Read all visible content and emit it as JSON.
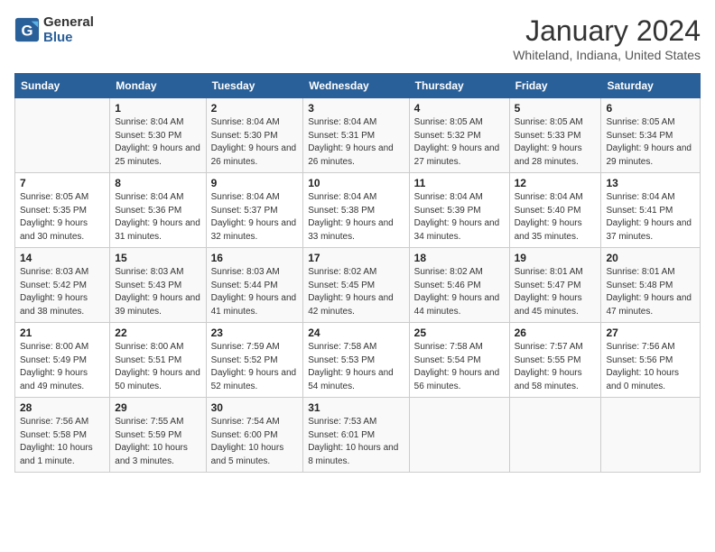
{
  "header": {
    "logo_line1": "General",
    "logo_line2": "Blue",
    "month": "January 2024",
    "location": "Whiteland, Indiana, United States"
  },
  "weekdays": [
    "Sunday",
    "Monday",
    "Tuesday",
    "Wednesday",
    "Thursday",
    "Friday",
    "Saturday"
  ],
  "weeks": [
    [
      {
        "day": "",
        "sunrise": "",
        "sunset": "",
        "daylight": ""
      },
      {
        "day": "1",
        "sunrise": "Sunrise: 8:04 AM",
        "sunset": "Sunset: 5:30 PM",
        "daylight": "Daylight: 9 hours and 25 minutes."
      },
      {
        "day": "2",
        "sunrise": "Sunrise: 8:04 AM",
        "sunset": "Sunset: 5:30 PM",
        "daylight": "Daylight: 9 hours and 26 minutes."
      },
      {
        "day": "3",
        "sunrise": "Sunrise: 8:04 AM",
        "sunset": "Sunset: 5:31 PM",
        "daylight": "Daylight: 9 hours and 26 minutes."
      },
      {
        "day": "4",
        "sunrise": "Sunrise: 8:05 AM",
        "sunset": "Sunset: 5:32 PM",
        "daylight": "Daylight: 9 hours and 27 minutes."
      },
      {
        "day": "5",
        "sunrise": "Sunrise: 8:05 AM",
        "sunset": "Sunset: 5:33 PM",
        "daylight": "Daylight: 9 hours and 28 minutes."
      },
      {
        "day": "6",
        "sunrise": "Sunrise: 8:05 AM",
        "sunset": "Sunset: 5:34 PM",
        "daylight": "Daylight: 9 hours and 29 minutes."
      }
    ],
    [
      {
        "day": "7",
        "sunrise": "Sunrise: 8:05 AM",
        "sunset": "Sunset: 5:35 PM",
        "daylight": "Daylight: 9 hours and 30 minutes."
      },
      {
        "day": "8",
        "sunrise": "Sunrise: 8:04 AM",
        "sunset": "Sunset: 5:36 PM",
        "daylight": "Daylight: 9 hours and 31 minutes."
      },
      {
        "day": "9",
        "sunrise": "Sunrise: 8:04 AM",
        "sunset": "Sunset: 5:37 PM",
        "daylight": "Daylight: 9 hours and 32 minutes."
      },
      {
        "day": "10",
        "sunrise": "Sunrise: 8:04 AM",
        "sunset": "Sunset: 5:38 PM",
        "daylight": "Daylight: 9 hours and 33 minutes."
      },
      {
        "day": "11",
        "sunrise": "Sunrise: 8:04 AM",
        "sunset": "Sunset: 5:39 PM",
        "daylight": "Daylight: 9 hours and 34 minutes."
      },
      {
        "day": "12",
        "sunrise": "Sunrise: 8:04 AM",
        "sunset": "Sunset: 5:40 PM",
        "daylight": "Daylight: 9 hours and 35 minutes."
      },
      {
        "day": "13",
        "sunrise": "Sunrise: 8:04 AM",
        "sunset": "Sunset: 5:41 PM",
        "daylight": "Daylight: 9 hours and 37 minutes."
      }
    ],
    [
      {
        "day": "14",
        "sunrise": "Sunrise: 8:03 AM",
        "sunset": "Sunset: 5:42 PM",
        "daylight": "Daylight: 9 hours and 38 minutes."
      },
      {
        "day": "15",
        "sunrise": "Sunrise: 8:03 AM",
        "sunset": "Sunset: 5:43 PM",
        "daylight": "Daylight: 9 hours and 39 minutes."
      },
      {
        "day": "16",
        "sunrise": "Sunrise: 8:03 AM",
        "sunset": "Sunset: 5:44 PM",
        "daylight": "Daylight: 9 hours and 41 minutes."
      },
      {
        "day": "17",
        "sunrise": "Sunrise: 8:02 AM",
        "sunset": "Sunset: 5:45 PM",
        "daylight": "Daylight: 9 hours and 42 minutes."
      },
      {
        "day": "18",
        "sunrise": "Sunrise: 8:02 AM",
        "sunset": "Sunset: 5:46 PM",
        "daylight": "Daylight: 9 hours and 44 minutes."
      },
      {
        "day": "19",
        "sunrise": "Sunrise: 8:01 AM",
        "sunset": "Sunset: 5:47 PM",
        "daylight": "Daylight: 9 hours and 45 minutes."
      },
      {
        "day": "20",
        "sunrise": "Sunrise: 8:01 AM",
        "sunset": "Sunset: 5:48 PM",
        "daylight": "Daylight: 9 hours and 47 minutes."
      }
    ],
    [
      {
        "day": "21",
        "sunrise": "Sunrise: 8:00 AM",
        "sunset": "Sunset: 5:49 PM",
        "daylight": "Daylight: 9 hours and 49 minutes."
      },
      {
        "day": "22",
        "sunrise": "Sunrise: 8:00 AM",
        "sunset": "Sunset: 5:51 PM",
        "daylight": "Daylight: 9 hours and 50 minutes."
      },
      {
        "day": "23",
        "sunrise": "Sunrise: 7:59 AM",
        "sunset": "Sunset: 5:52 PM",
        "daylight": "Daylight: 9 hours and 52 minutes."
      },
      {
        "day": "24",
        "sunrise": "Sunrise: 7:58 AM",
        "sunset": "Sunset: 5:53 PM",
        "daylight": "Daylight: 9 hours and 54 minutes."
      },
      {
        "day": "25",
        "sunrise": "Sunrise: 7:58 AM",
        "sunset": "Sunset: 5:54 PM",
        "daylight": "Daylight: 9 hours and 56 minutes."
      },
      {
        "day": "26",
        "sunrise": "Sunrise: 7:57 AM",
        "sunset": "Sunset: 5:55 PM",
        "daylight": "Daylight: 9 hours and 58 minutes."
      },
      {
        "day": "27",
        "sunrise": "Sunrise: 7:56 AM",
        "sunset": "Sunset: 5:56 PM",
        "daylight": "Daylight: 10 hours and 0 minutes."
      }
    ],
    [
      {
        "day": "28",
        "sunrise": "Sunrise: 7:56 AM",
        "sunset": "Sunset: 5:58 PM",
        "daylight": "Daylight: 10 hours and 1 minute."
      },
      {
        "day": "29",
        "sunrise": "Sunrise: 7:55 AM",
        "sunset": "Sunset: 5:59 PM",
        "daylight": "Daylight: 10 hours and 3 minutes."
      },
      {
        "day": "30",
        "sunrise": "Sunrise: 7:54 AM",
        "sunset": "Sunset: 6:00 PM",
        "daylight": "Daylight: 10 hours and 5 minutes."
      },
      {
        "day": "31",
        "sunrise": "Sunrise: 7:53 AM",
        "sunset": "Sunset: 6:01 PM",
        "daylight": "Daylight: 10 hours and 8 minutes."
      },
      {
        "day": "",
        "sunrise": "",
        "sunset": "",
        "daylight": ""
      },
      {
        "day": "",
        "sunrise": "",
        "sunset": "",
        "daylight": ""
      },
      {
        "day": "",
        "sunrise": "",
        "sunset": "",
        "daylight": ""
      }
    ]
  ]
}
